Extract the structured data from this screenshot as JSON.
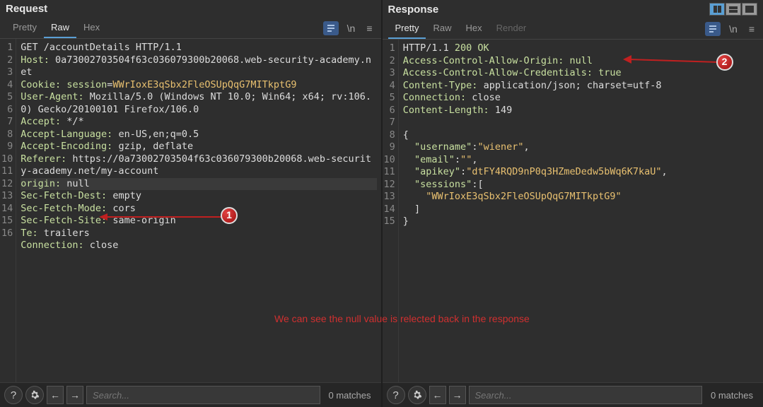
{
  "request": {
    "title": "Request",
    "tabs": [
      "Pretty",
      "Raw",
      "Hex"
    ],
    "active_tab": "Raw",
    "lines": [
      [
        {
          "t": "GET /accountDetails HTTP/1.1",
          "c": ""
        }
      ],
      [
        {
          "t": "Host:",
          "c": "hl"
        },
        {
          "t": " 0a73002703504f63c036079300b20068.web-security-academy.net",
          "c": ""
        }
      ],
      [
        {
          "t": "Cookie:",
          "c": "hl"
        },
        {
          "t": " ",
          "c": ""
        },
        {
          "t": "session",
          "c": "hl"
        },
        {
          "t": "=",
          "c": ""
        },
        {
          "t": "WWrIoxE3qSbx2FleOSUpQqG7MITkptG9",
          "c": "str"
        }
      ],
      [
        {
          "t": "User-Agent:",
          "c": "hl"
        },
        {
          "t": " Mozilla/5.0 (Windows NT 10.0; Win64; x64; rv:106.0) Gecko/20100101 Firefox/106.0",
          "c": ""
        }
      ],
      [
        {
          "t": "Accept:",
          "c": "hl"
        },
        {
          "t": " */*",
          "c": ""
        }
      ],
      [
        {
          "t": "Accept-Language:",
          "c": "hl"
        },
        {
          "t": " en-US,en;q=0.5",
          "c": ""
        }
      ],
      [
        {
          "t": "Accept-Encoding:",
          "c": "hl"
        },
        {
          "t": " gzip, deflate",
          "c": ""
        }
      ],
      [
        {
          "t": "Referer:",
          "c": "hl"
        },
        {
          "t": " https://0a73002703504f63c036079300b20068.web-security-academy.net/my-account",
          "c": ""
        }
      ],
      [
        {
          "t": "origin: ",
          "c": "hl",
          "hlrow": true
        },
        {
          "t": "null",
          "c": "",
          "hlrow": true
        }
      ],
      [
        {
          "t": "Sec-Fetch-Dest:",
          "c": "hl"
        },
        {
          "t": " empty",
          "c": ""
        }
      ],
      [
        {
          "t": "Sec-Fetch-Mode:",
          "c": "hl"
        },
        {
          "t": " cors",
          "c": ""
        }
      ],
      [
        {
          "t": "Sec-Fetch-Site:",
          "c": "hl"
        },
        {
          "t": " same-origin",
          "c": ""
        }
      ],
      [
        {
          "t": "Te:",
          "c": "hl"
        },
        {
          "t": " trailers",
          "c": ""
        }
      ],
      [
        {
          "t": "Connection:",
          "c": "hl"
        },
        {
          "t": " close",
          "c": ""
        }
      ],
      [
        {
          "t": "",
          "c": ""
        }
      ],
      [
        {
          "t": "",
          "c": ""
        }
      ]
    ],
    "line_numbers_explicit": [
      1,
      2,
      null,
      3,
      4,
      null,
      5,
      6,
      7,
      8,
      null,
      9,
      10,
      11,
      12,
      13,
      14,
      15,
      16
    ],
    "search_placeholder": "Search...",
    "matches": "0 matches"
  },
  "response": {
    "title": "Response",
    "tabs": [
      "Pretty",
      "Raw",
      "Hex",
      "Render"
    ],
    "active_tab": "Pretty",
    "lines": [
      [
        {
          "t": "HTTP/1.1 ",
          "c": ""
        },
        {
          "t": "200 OK",
          "c": "hl"
        }
      ],
      [
        {
          "t": "Access-Control-Allow-Origin:",
          "c": "hl"
        },
        {
          "t": " ",
          "c": ""
        },
        {
          "t": "null",
          "c": "hl"
        }
      ],
      [
        {
          "t": "Access-Control-Allow-Credentials:",
          "c": "hl"
        },
        {
          "t": " ",
          "c": ""
        },
        {
          "t": "true",
          "c": "hl"
        }
      ],
      [
        {
          "t": "Content-Type:",
          "c": "hl"
        },
        {
          "t": " application/json; charset=utf-8",
          "c": ""
        }
      ],
      [
        {
          "t": "Connection:",
          "c": "hl"
        },
        {
          "t": " close",
          "c": ""
        }
      ],
      [
        {
          "t": "Content-Length:",
          "c": "hl"
        },
        {
          "t": " 149",
          "c": ""
        }
      ],
      [
        {
          "t": "",
          "c": ""
        }
      ],
      [
        {
          "t": "{",
          "c": ""
        }
      ],
      [
        {
          "t": "  \"username\"",
          "c": "key"
        },
        {
          "t": ":",
          "c": ""
        },
        {
          "t": "\"wiener\"",
          "c": "str"
        },
        {
          "t": ",",
          "c": ""
        }
      ],
      [
        {
          "t": "  \"email\"",
          "c": "key"
        },
        {
          "t": ":",
          "c": ""
        },
        {
          "t": "\"\"",
          "c": "str"
        },
        {
          "t": ",",
          "c": ""
        }
      ],
      [
        {
          "t": "  \"apikey\"",
          "c": "key"
        },
        {
          "t": ":",
          "c": ""
        },
        {
          "t": "\"dtFY4RQD9nP0q3HZmeDedw5bWq6K7kaU\"",
          "c": "str"
        },
        {
          "t": ",",
          "c": ""
        }
      ],
      [
        {
          "t": "  \"sessions\"",
          "c": "key"
        },
        {
          "t": ":[",
          "c": ""
        }
      ],
      [
        {
          "t": "    \"WWrIoxE3qSbx2FleOSUpQqG7MITkptG9\"",
          "c": "str"
        }
      ],
      [
        {
          "t": "  ]",
          "c": ""
        }
      ],
      [
        {
          "t": "}",
          "c": ""
        }
      ]
    ],
    "search_placeholder": "Search...",
    "matches": "0 matches"
  },
  "annotations": {
    "badge1": "1",
    "badge2": "2",
    "text": "We can see the null value is relected back in the response"
  }
}
